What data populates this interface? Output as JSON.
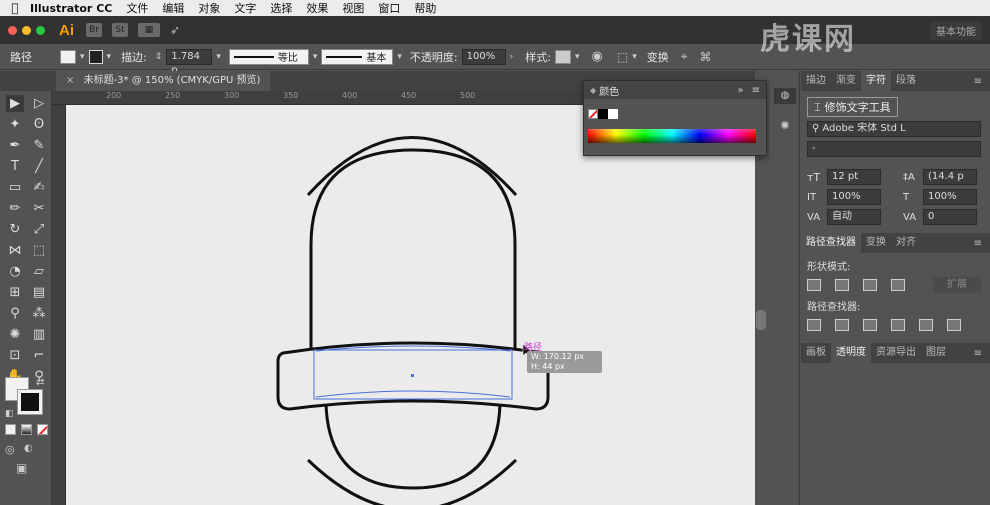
{
  "menubar": {
    "app_name": "Illustrator CC",
    "items": [
      "文件",
      "编辑",
      "对象",
      "文字",
      "选择",
      "效果",
      "视图",
      "窗口",
      "帮助"
    ]
  },
  "appbar": {
    "logo": "Ai",
    "workspace": "基本功能"
  },
  "control": {
    "object_type": "路径",
    "stroke_label": "描边:",
    "stroke_value": "1.784 p",
    "profile_label": "等比",
    "brush_label": "基本",
    "opacity_label": "不透明度:",
    "opacity_value": "100%",
    "style_label": "样式:",
    "transform_label": "变换"
  },
  "doc_tab": {
    "title": "未标题-3* @ 150% (CMYK/GPU 预览)"
  },
  "ruler": {
    "ticks": [
      "200",
      "250",
      "300",
      "350",
      "400",
      "450",
      "500"
    ]
  },
  "color_panel": {
    "title": "颜色",
    "swatches": [
      "none",
      "black",
      "white"
    ]
  },
  "dock": {
    "top_tabs": [
      "描边",
      "渐变",
      "字符",
      "段落"
    ],
    "active_top_tab": "字符",
    "touch_type_btn": "修饰文字工具",
    "font_family": "Adobe 宋体 Std L",
    "font_style": "-",
    "font_size": "12 pt",
    "leading": "(14.4 p",
    "vscale": "100%",
    "hscale": "100%",
    "kerning": "自动",
    "tracking": "0",
    "pf_tabs": [
      "路径查找器",
      "变换",
      "对齐"
    ],
    "active_pf_tab": "路径查找器",
    "shape_modes_label": "形状模式:",
    "expand_btn": "扩展",
    "pathfinders_label": "路径查找器:",
    "bottom_tabs": [
      "画板",
      "透明度",
      "资源导出",
      "图层"
    ],
    "active_bottom_tab": "透明度"
  },
  "canvas": {
    "path_label": "路径",
    "tooltip_w": "W: 170.12 px",
    "tooltip_h": "H: 44 px"
  },
  "watermark": "虎课网",
  "colors": {
    "accent_ai": "#ff9a00",
    "selection_blue": "#4a6fd8",
    "path_magenta": "#d33ad3"
  }
}
